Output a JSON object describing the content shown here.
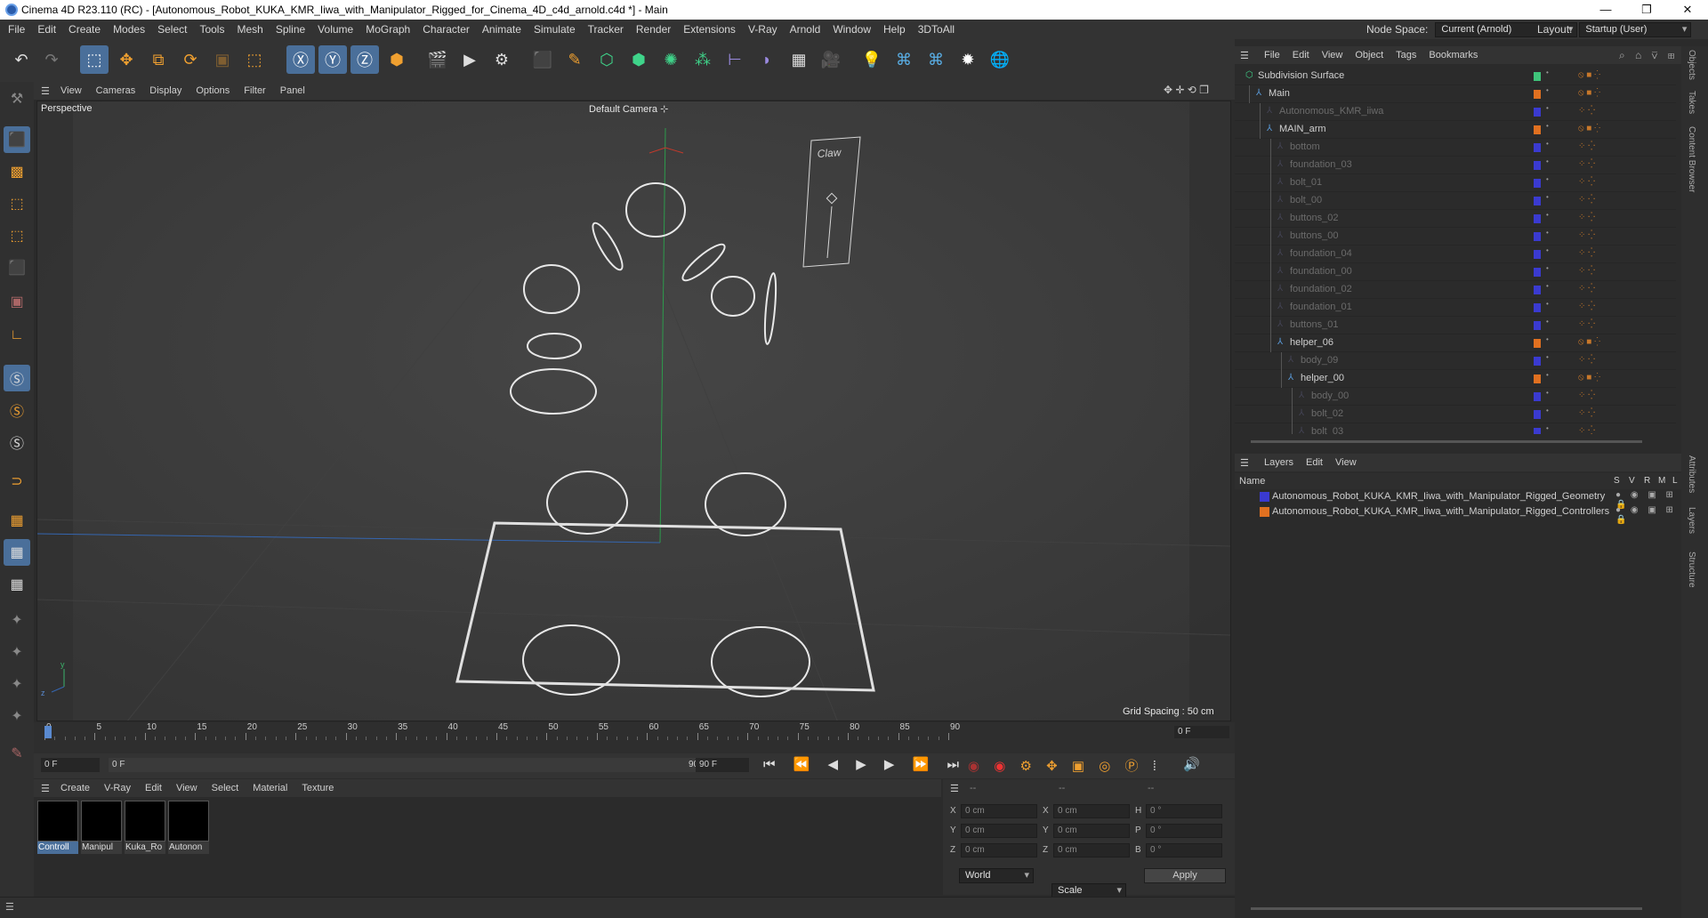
{
  "window": {
    "title": "Cinema 4D R23.110 (RC) - [Autonomous_Robot_KUKA_KMR_Iiwa_with_Manipulator_Rigged_for_Cinema_4D_c4d_arnold.c4d *] - Main"
  },
  "menubar": {
    "items": [
      "File",
      "Edit",
      "Create",
      "Modes",
      "Select",
      "Tools",
      "Mesh",
      "Spline",
      "Volume",
      "MoGraph",
      "Character",
      "Animate",
      "Simulate",
      "Tracker",
      "Render",
      "Extensions",
      "V-Ray",
      "Arnold",
      "Window",
      "Help",
      "3DToAll"
    ],
    "node_space_label": "Node Space:",
    "node_space_value": "Current (Arnold)",
    "layout_label": "Layout:",
    "layout_value": "Startup (User)"
  },
  "viewport": {
    "menu": [
      "View",
      "Cameras",
      "Display",
      "Options",
      "Filter",
      "Panel"
    ],
    "view_name": "Perspective",
    "camera": "Default Camera",
    "grid_spacing": "Grid Spacing : 50 cm",
    "claw_label": "Claw",
    "axis_y": "y",
    "axis_z": "z"
  },
  "timeline": {
    "ticks": [
      "0",
      "5",
      "10",
      "15",
      "20",
      "25",
      "30",
      "35",
      "40",
      "45",
      "50",
      "55",
      "60",
      "65",
      "70",
      "75",
      "80",
      "85",
      "90"
    ],
    "current_frame": "0 F",
    "start_frame": "0 F",
    "range_start": "0 F",
    "range_end": "90 F",
    "end_frame": "90 F"
  },
  "materials": {
    "menu": [
      "Create",
      "V-Ray",
      "Edit",
      "View",
      "Select",
      "Material",
      "Texture"
    ],
    "items": [
      "Controll",
      "Manipul",
      "Kuka_Ro",
      "Autonon"
    ]
  },
  "coordinates": {
    "header": [
      "--",
      "--",
      "--"
    ],
    "rows": [
      {
        "a": "X",
        "av": "0 cm",
        "b": "X",
        "bv": "0 cm",
        "c": "H",
        "cv": "0 °"
      },
      {
        "a": "Y",
        "av": "0 cm",
        "b": "Y",
        "bv": "0 cm",
        "c": "P",
        "cv": "0 °"
      },
      {
        "a": "Z",
        "av": "0 cm",
        "b": "Z",
        "bv": "0 cm",
        "c": "B",
        "cv": "0 °"
      }
    ],
    "space": "World",
    "mode": "Scale",
    "apply": "Apply"
  },
  "objects": {
    "menu": [
      "File",
      "Edit",
      "View",
      "Object",
      "Tags",
      "Bookmarks"
    ],
    "rows": [
      {
        "name": "Subdivision Surface",
        "level": 0,
        "dim": false,
        "color": "#3fc47a"
      },
      {
        "name": "Main",
        "level": 1,
        "dim": false,
        "color": "#e07020"
      },
      {
        "name": "Autonomous_KMR_iiwa",
        "level": 2,
        "dim": true,
        "color": "#3a3ad0"
      },
      {
        "name": "MAIN_arm",
        "level": 2,
        "dim": false,
        "color": "#e07020"
      },
      {
        "name": "bottom",
        "level": 3,
        "dim": true,
        "color": "#3a3ad0"
      },
      {
        "name": "foundation_03",
        "level": 3,
        "dim": true,
        "color": "#3a3ad0"
      },
      {
        "name": "bolt_01",
        "level": 3,
        "dim": true,
        "color": "#3a3ad0"
      },
      {
        "name": "bolt_00",
        "level": 3,
        "dim": true,
        "color": "#3a3ad0"
      },
      {
        "name": "buttons_02",
        "level": 3,
        "dim": true,
        "color": "#3a3ad0"
      },
      {
        "name": "buttons_00",
        "level": 3,
        "dim": true,
        "color": "#3a3ad0"
      },
      {
        "name": "foundation_04",
        "level": 3,
        "dim": true,
        "color": "#3a3ad0"
      },
      {
        "name": "foundation_00",
        "level": 3,
        "dim": true,
        "color": "#3a3ad0"
      },
      {
        "name": "foundation_02",
        "level": 3,
        "dim": true,
        "color": "#3a3ad0"
      },
      {
        "name": "foundation_01",
        "level": 3,
        "dim": true,
        "color": "#3a3ad0"
      },
      {
        "name": "buttons_01",
        "level": 3,
        "dim": true,
        "color": "#3a3ad0"
      },
      {
        "name": "helper_06",
        "level": 3,
        "dim": false,
        "color": "#e07020"
      },
      {
        "name": "body_09",
        "level": 4,
        "dim": true,
        "color": "#3a3ad0"
      },
      {
        "name": "helper_00",
        "level": 4,
        "dim": false,
        "color": "#e07020"
      },
      {
        "name": "body_00",
        "level": 5,
        "dim": true,
        "color": "#3a3ad0"
      },
      {
        "name": "bolt_02",
        "level": 5,
        "dim": true,
        "color": "#3a3ad0"
      },
      {
        "name": "bolt_03",
        "level": 5,
        "dim": true,
        "color": "#3a3ad0"
      }
    ]
  },
  "layers": {
    "menu": [
      "Layers",
      "Edit",
      "View"
    ],
    "columns": [
      "Name",
      "S",
      "V",
      "R",
      "M",
      "L"
    ],
    "rows": [
      {
        "name": "Autonomous_Robot_KUKA_KMR_Iiwa_with_Manipulator_Rigged_Geometry",
        "color": "#3a3ad0"
      },
      {
        "name": "Autonomous_Robot_KUKA_KMR_Iiwa_with_Manipulator_Rigged_Controllers",
        "color": "#e07020"
      }
    ]
  },
  "side_tabs": [
    "Objects",
    "Takes",
    "Content Browser",
    "Attributes",
    "Layers",
    "Structure"
  ]
}
